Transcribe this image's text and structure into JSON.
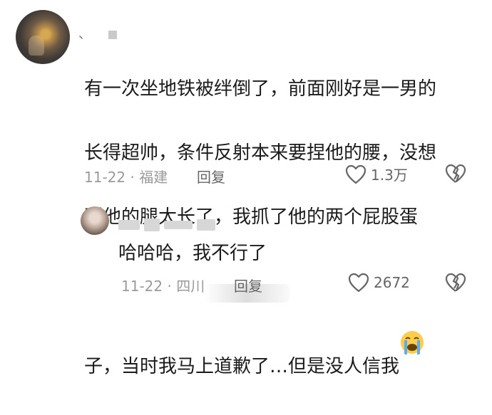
{
  "comment": {
    "username_visible": "、",
    "text_lines": [
      "有一次坐地铁被绊倒了，前面刚好是一男的",
      "长得超帅，条件反射本来要捏他的腰，没想",
      "到他的腿太长了，我抓了他的两个屁股蛋",
      "子，当时我马上道歉了…但是没人信我"
    ],
    "emoji": "crying-face-icon",
    "date": "11-22",
    "location": "福建",
    "reply_label": "回复",
    "like_count": "1.3万"
  },
  "sub_reply": {
    "text": "哈哈哈，我不行了",
    "date": "11-22",
    "location": "四川",
    "reply_label": "回复",
    "like_count": "2672"
  },
  "colors": {
    "text": "#1b1b1b",
    "meta": "#9a9a9a",
    "icon": "#666666",
    "emoji_face": "#ffcc4d",
    "tears": "#5dadec"
  }
}
